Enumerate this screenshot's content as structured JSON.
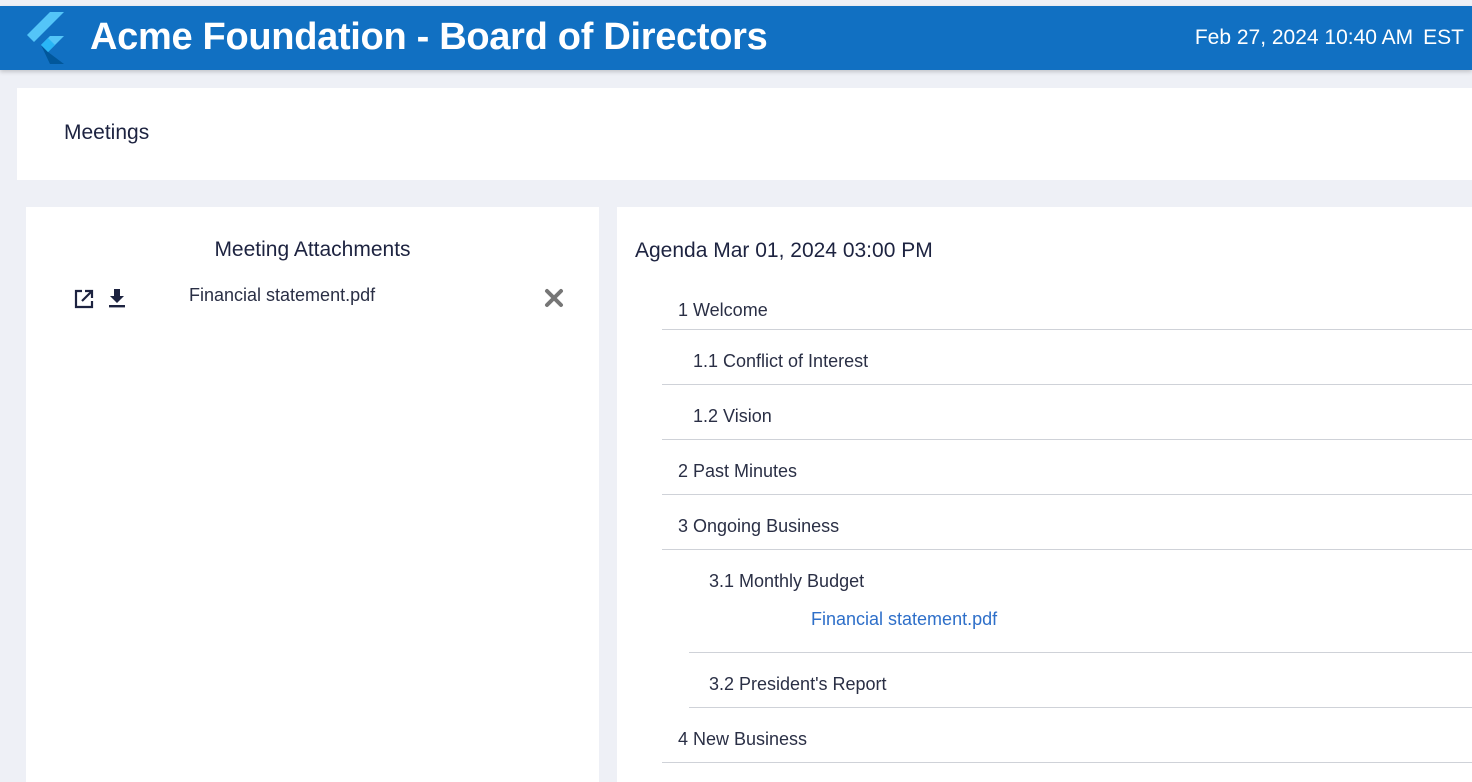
{
  "app": {
    "title": "Acme Foundation - Board of Directors",
    "date_time": "Feb 27, 2024 10:40 AM",
    "timezone": "EST",
    "brand_color": "#1170c2"
  },
  "page": {
    "title": "Meetings"
  },
  "attachments": {
    "title": "Meeting Attachments",
    "items": [
      {
        "name": "Financial statement.pdf",
        "icons": [
          "open-external-icon",
          "download-icon",
          "remove-icon"
        ]
      }
    ]
  },
  "agenda": {
    "title": "Agenda Mar 01, 2024 03:00 PM",
    "items": [
      {
        "label": "1 Welcome",
        "level": 1
      },
      {
        "label": "1.1 Conflict of Interest",
        "level": 2
      },
      {
        "label": "1.2 Vision",
        "level": 2
      },
      {
        "label": "2 Past Minutes",
        "level": 1
      },
      {
        "label": "3 Ongoing Business",
        "level": 1
      },
      {
        "label": "3.1 Monthly Budget",
        "level": 3,
        "attachment": "Financial statement.pdf"
      },
      {
        "label": "3.2 President's Report",
        "level": 3
      },
      {
        "label": "4 New Business",
        "level": 1
      }
    ],
    "link_color": "#2e6fc9"
  }
}
